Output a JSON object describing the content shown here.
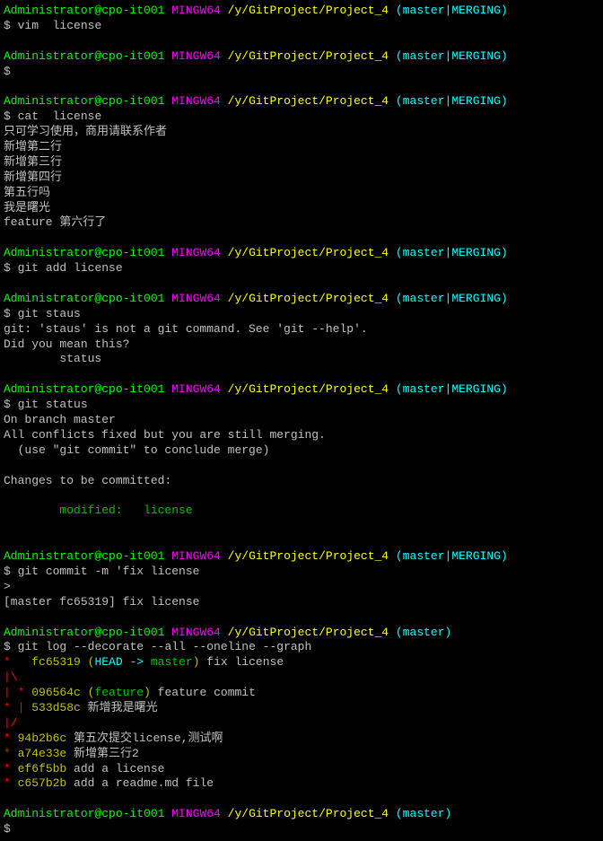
{
  "prompt": {
    "user": "Administrator@cpo-it001",
    "env": "MINGW64",
    "path": "/y/GitProject/Project_4",
    "branch_merging": "(master|MERGING)",
    "branch_master": "(master)",
    "dollar": "$"
  },
  "blocks": [
    {
      "cmd": "vim  license"
    },
    {
      "cmd": ""
    },
    {
      "cmd": "cat  license",
      "output": [
        "只可学习使用，商用请联系作者",
        "新增第二行",
        "新增第三行",
        "新增第四行",
        "第五行吗",
        "我是曙光",
        "feature 第六行了"
      ]
    },
    {
      "cmd": "git add license"
    },
    {
      "cmd": "git staus",
      "output": [
        "git: 'staus' is not a git command. See 'git --help'.",
        "",
        "Did you mean this?",
        "        status"
      ]
    },
    {
      "cmd": "git status"
    }
  ],
  "status": {
    "branch": "On branch master",
    "conflicts": "All conflicts fixed but you are still merging.",
    "hint": "  (use \"git commit\" to conclude merge)",
    "changes_header": "Changes to be committed:",
    "modified": "        modified:   license"
  },
  "commit": {
    "cmd": "git commit -m 'fix license",
    "cont": ">",
    "result": "[master fc65319] fix license"
  },
  "log": {
    "cmd": "git log --decorate --all --oneline --graph",
    "entries": {
      "l1_star": "*",
      "l1_hash": "fc65319",
      "l1_refs_open": "(",
      "l1_head": "HEAD -> ",
      "l1_master": "master",
      "l1_refs_close": ")",
      "l1_msg": " fix license",
      "l2_graph": "|\\",
      "l3_graph": "| ",
      "l3_star": "*",
      "l3_hash": " 096564c",
      "l3_refs": " (",
      "l3_feature": "feature",
      "l3_refs_close": ")",
      "l3_msg": " feature commit",
      "l4_star": "*",
      "l4_graph": " |",
      "l4_hash": " 533d58c",
      "l4_msg": " 新增我是曙光",
      "l5_graph": "|/",
      "l6_star": "*",
      "l6_hash": " 94b2b6c",
      "l6_msg": " 第五次提交license,测试啊",
      "l7_star": "*",
      "l7_hash": " a74e33e",
      "l7_msg": " 新增第三行2",
      "l8_star": "*",
      "l8_hash": " ef6f5bb",
      "l8_msg": " add a license",
      "l9_star": "*",
      "l9_hash": " c657b2b",
      "l9_msg": " add a readme.md file"
    }
  }
}
